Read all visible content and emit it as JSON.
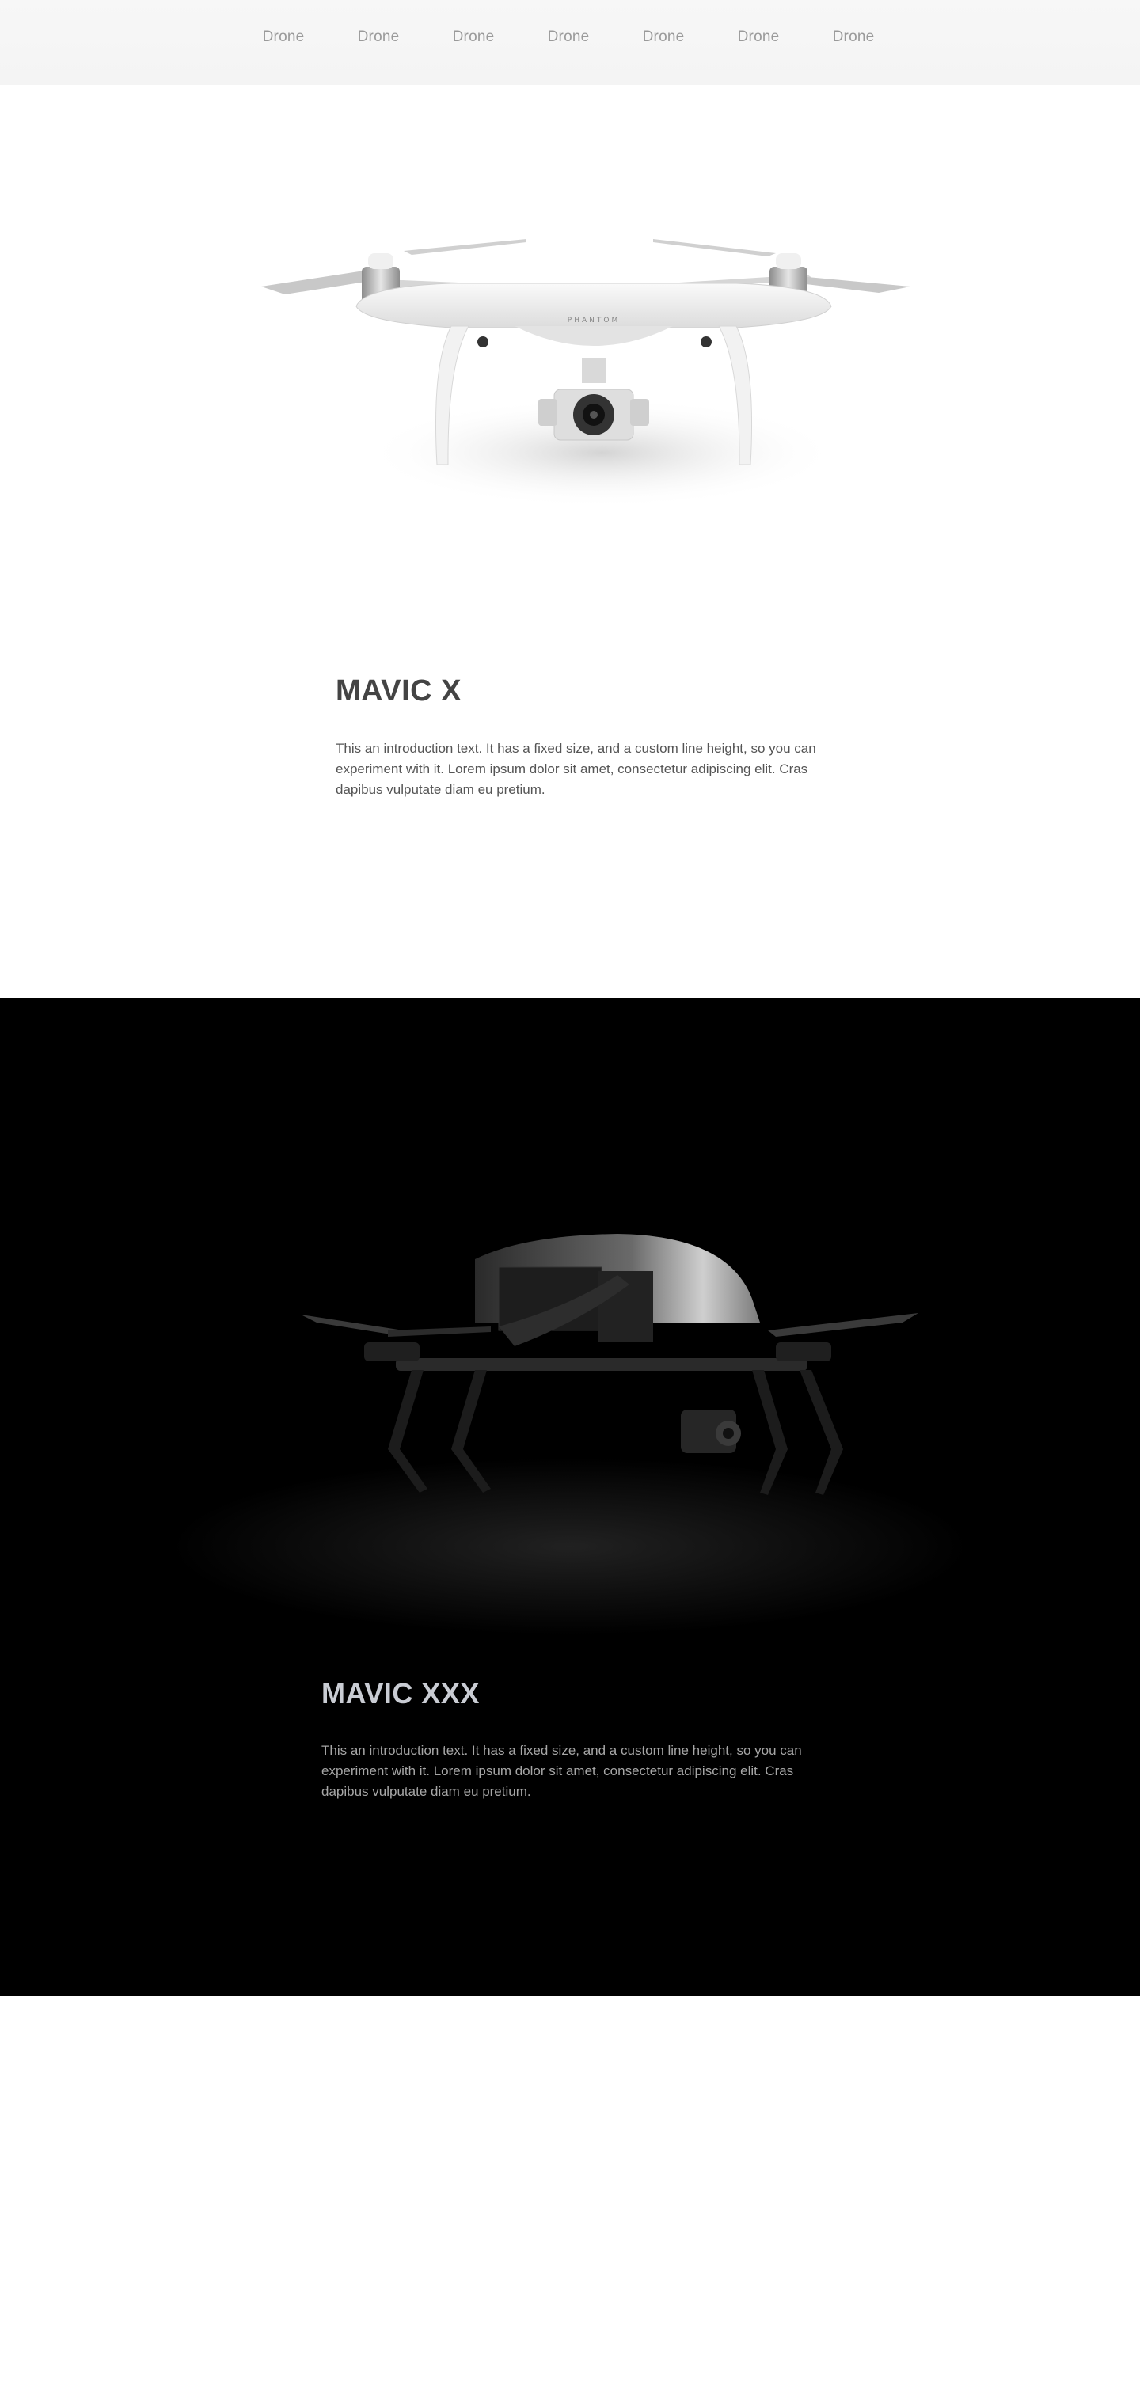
{
  "nav": {
    "items": [
      "Drone",
      "Drone",
      "Drone",
      "Drone",
      "Drone",
      "Drone",
      "Drone"
    ]
  },
  "section_light": {
    "product_image": "phantom-drone-white",
    "drone_badge": "PHANTOM",
    "title": "MAVIC X",
    "intro": "This an introduction text. It has a fixed size, and a custom line height, so you can experiment with it. Lorem ipsum dolor sit amet, consectetur adipiscing elit. Cras dapibus vulputate diam eu pretium."
  },
  "section_dark": {
    "product_image": "inspire-drone-dark",
    "title": "MAVIC XXX",
    "intro": "This an introduction text. It has a fixed size, and a custom line height, so you can experiment with it. Lorem ipsum dolor sit amet, consectetur adipiscing elit. Cras dapibus vulputate diam eu pretium."
  },
  "colors": {
    "nav_bg": "#f5f5f5",
    "nav_text": "#9a9a9a",
    "light_title": "#444444",
    "dark_bg": "#000000",
    "dark_title": "#c9ccd3",
    "dark_text": "#a6a6a6"
  }
}
